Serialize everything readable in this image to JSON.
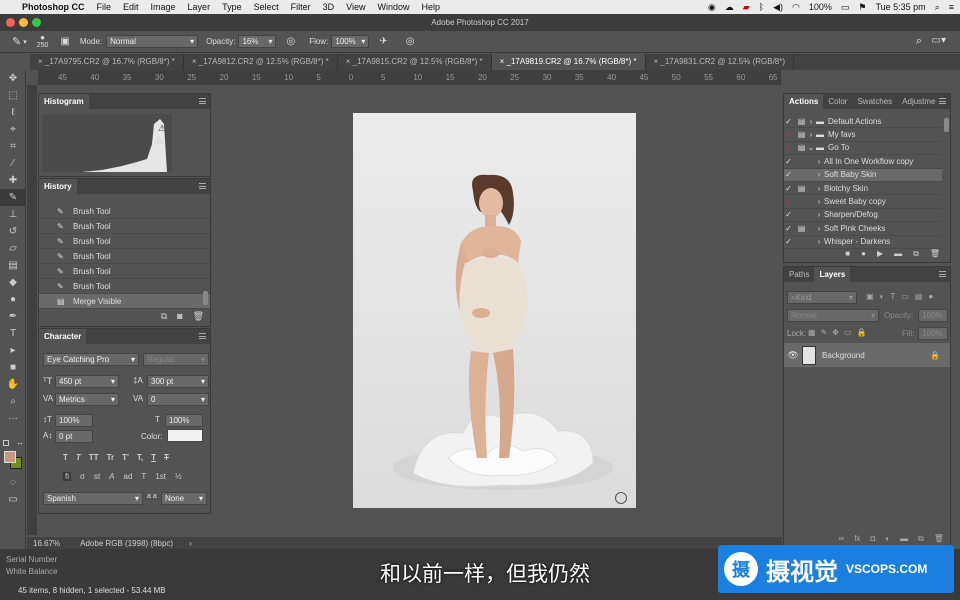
{
  "menubar": {
    "app": "Photoshop CC",
    "items": [
      "File",
      "Edit",
      "Image",
      "Layer",
      "Type",
      "Select",
      "Filter",
      "3D",
      "View",
      "Window",
      "Help"
    ],
    "battery": "100%",
    "clock": "Tue 5:35 pm"
  },
  "window": {
    "title": "Adobe Photoshop CC 2017"
  },
  "options": {
    "brush_size": "250",
    "mode_label": "Mode:",
    "mode_value": "Normal",
    "opacity_label": "Opacity:",
    "opacity_value": "16%",
    "flow_label": "Flow:",
    "flow_value": "100%"
  },
  "doc_tabs": [
    {
      "label": "_17A9795.CR2 @ 16.7% (RGB/8*) *"
    },
    {
      "label": "_17A9812.CR2 @ 12.5% (RGB/8*) *"
    },
    {
      "label": "_17A9815.CR2 @ 12.5% (RGB/8*) *"
    },
    {
      "label": "_17A9819.CR2 @ 16.7% (RGB/8*) *",
      "active": true
    },
    {
      "label": "_17A9831.CR2 @ 12.5% (RGB/8*)"
    }
  ],
  "ruler": {
    "h_ticks": [
      "45",
      "40",
      "35",
      "30",
      "25",
      "20",
      "15",
      "10",
      "5",
      "0",
      "5",
      "10",
      "15",
      "20",
      "25",
      "30",
      "35",
      "40",
      "45",
      "50",
      "55",
      "60",
      "65"
    ]
  },
  "histogram": {
    "title": "Histogram"
  },
  "history": {
    "title": "History",
    "items": [
      "Brush Tool",
      "Brush Tool",
      "Brush Tool",
      "Brush Tool",
      "Brush Tool",
      "Brush Tool",
      "Merge Visible"
    ]
  },
  "character": {
    "title": "Character",
    "font_family": "Eye Catching Pro",
    "font_style": "Regular",
    "size": "450 pt",
    "leading": "300 pt",
    "kerning": "Metrics",
    "tracking": "0",
    "vscale": "100%",
    "hscale": "100%",
    "baseline": "0 pt",
    "color_label": "Color:",
    "language": "Spanish",
    "aa_label": "a a",
    "aa_value": "None",
    "type_buttons": [
      "T",
      "T",
      "TT",
      "Tr",
      "T'",
      "T,",
      "T",
      "T"
    ],
    "ot_buttons": [
      "fi",
      "σ",
      "st",
      "A",
      "ad",
      "T",
      "1st",
      "½"
    ]
  },
  "actions_panel": {
    "tabs": [
      "Actions",
      "Color",
      "Swatches",
      "Adjustme"
    ],
    "items": [
      "Default Actions",
      "My favs",
      "Go To",
      "All In One Workflow copy",
      "Soft Baby Skin",
      "Blotchy Skin",
      "Sweet Baby copy",
      "Sharpen/Defog",
      "Soft Pink Cheeks",
      "Whisper - Darkens"
    ]
  },
  "layers_panel": {
    "tabs": [
      "Paths",
      "Layers"
    ],
    "kind_label": "Kind",
    "blend_mode": "Normal",
    "opacity_label": "Opacity:",
    "opacity_value": "100%",
    "lock_label": "Lock:",
    "fill_label": "Fill:",
    "fill_value": "100%",
    "layer_name": "Background"
  },
  "status": {
    "zoom": "16.67%",
    "profile": "Adobe RGB (1998) (8bpc)"
  },
  "bottom_strip": {
    "line1": "Serial Number",
    "line2": "White Balance",
    "info": "45 items, 8 hidden, 1 selected - 53.44 MB"
  },
  "subtitle": "和以前一样，但我仍然",
  "watermark": {
    "logo_char": "摄",
    "brand": "摄视觉",
    "url": "VSCOPS.COM"
  },
  "colors": {
    "accent": "#1b7fe0",
    "foreground_swatch": "#c9977c",
    "background_swatch": "#6f8c1e"
  }
}
